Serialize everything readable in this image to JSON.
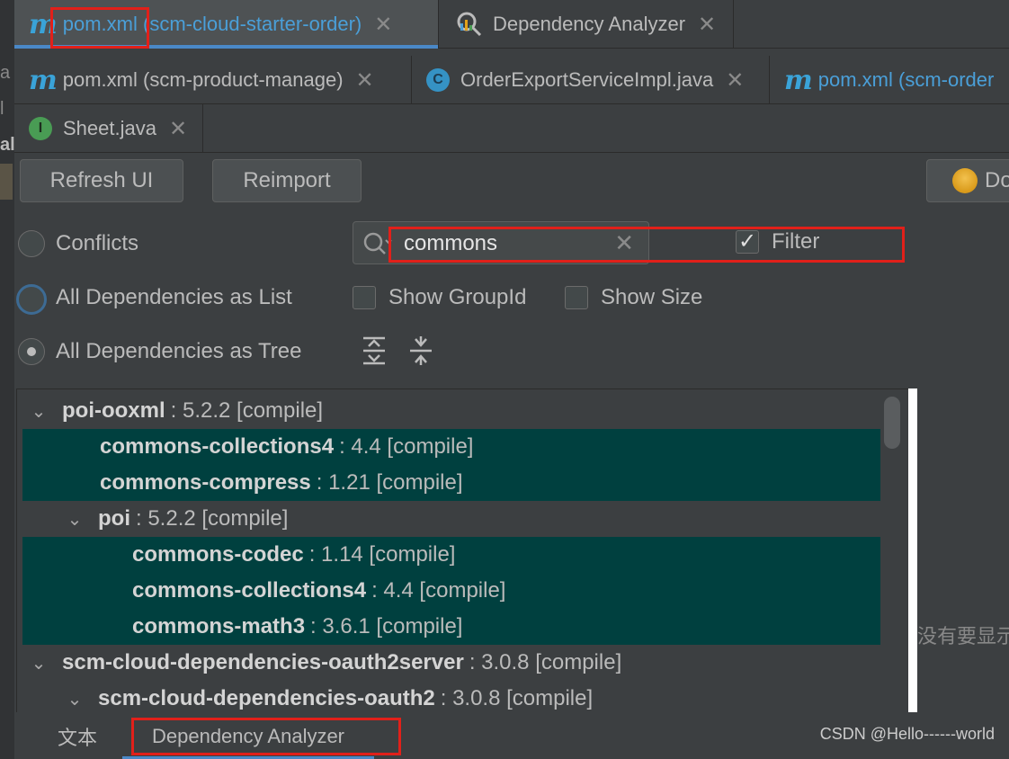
{
  "editor_tabs": {
    "row1": [
      {
        "file": "pom.xml",
        "module": "(scm-cloud-starter-order)",
        "active": true
      },
      {
        "title": "Dependency Analyzer"
      }
    ],
    "row2": [
      {
        "file": "pom.xml",
        "module": "(scm-product-manage)"
      },
      {
        "title": "OrderExportServiceImpl.java"
      },
      {
        "file": "pom.xml",
        "module": "(scm-order"
      }
    ],
    "row3": [
      {
        "title": "Sheet.java"
      }
    ]
  },
  "toolbar": {
    "refresh_label": "Refresh UI",
    "reimport_label": "Reimport",
    "download_label": "Do"
  },
  "view_options": {
    "conflicts": "Conflicts",
    "as_list": "All Dependencies as List",
    "as_tree": "All Dependencies as Tree",
    "selected": "as_tree",
    "show_groupid": "Show GroupId",
    "show_size": "Show Size",
    "filter_label": "Filter",
    "filter_checked": true
  },
  "search": {
    "value": "commons"
  },
  "tree": [
    {
      "name": "poi-ooxml",
      "info": ": 5.2.2 [compile]",
      "expanded": true,
      "highlight": false
    },
    {
      "name": "commons-collections4",
      "info": ": 4.4 [compile]",
      "highlight": true
    },
    {
      "name": "commons-compress",
      "info": ": 1.21 [compile]",
      "highlight": true
    },
    {
      "name": "poi",
      "info": ": 5.2.2 [compile]",
      "expanded": true,
      "highlight": false
    },
    {
      "name": "commons-codec",
      "info": ": 1.14 [compile]",
      "highlight": true
    },
    {
      "name": "commons-collections4",
      "info": ": 4.4 [compile]",
      "highlight": true
    },
    {
      "name": "commons-math3",
      "info": ": 3.6.1 [compile]",
      "highlight": true
    },
    {
      "name": "scm-cloud-dependencies-oauth2server",
      "info": ": 3.0.8 [compile]",
      "expanded": true,
      "highlight": false
    },
    {
      "name": "scm-cloud-dependencies-oauth2",
      "info": ": 3.0.8 [compile]",
      "expanded": true,
      "highlight": false
    }
  ],
  "side_panel_text": "没有要显示",
  "bottom_tabs": {
    "text": "文本",
    "analyzer": "Dependency Analyzer"
  },
  "watermark": "CSDN @Hello------world",
  "gutter_chars": [
    "a",
    "l",
    "al"
  ],
  "colors": {
    "accent": "#4a88c7",
    "highlight_row": "#00403f",
    "annotation_red": "#e1201a"
  }
}
